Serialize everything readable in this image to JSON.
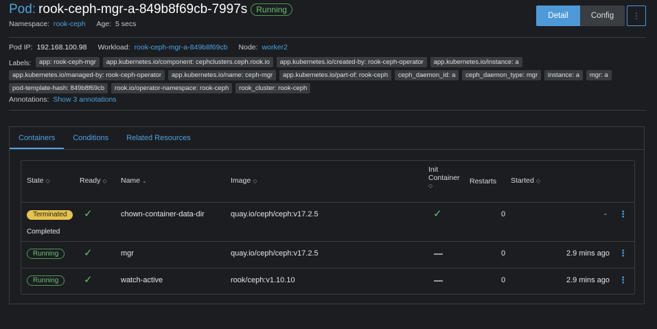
{
  "header": {
    "kind": "Pod:",
    "name": "rook-ceph-mgr-a-849b8f69cb-7997s",
    "status": "Running",
    "namespace_label": "Namespace:",
    "namespace": "rook-ceph",
    "age_label": "Age:",
    "age": "5 secs"
  },
  "buttons": {
    "detail": "Detail",
    "config": "Config",
    "more": "⋮"
  },
  "info": {
    "pod_ip_label": "Pod IP:",
    "pod_ip": "192.168.100.98",
    "workload_label": "Workload:",
    "workload": "rook-ceph-mgr-a-849b8f69cb",
    "node_label": "Node:",
    "node": "worker2"
  },
  "labels_heading": "Labels:",
  "labels": [
    "app: rook-ceph-mgr",
    "app.kubernetes.io/component: cephclusters.ceph.rook.io",
    "app.kubernetes.io/created-by: rook-ceph-operator",
    "app.kubernetes.io/instance: a",
    "app.kubernetes.io/managed-by: rook-ceph-operator",
    "app.kubernetes.io/name: ceph-mgr",
    "app.kubernetes.io/part-of: rook-ceph",
    "ceph_daemon_id: a",
    "ceph_daemon_type: mgr",
    "instance: a",
    "mgr: a",
    "pod-template-hash: 849b8f69cb",
    "rook.io/operator-namespace: rook-ceph",
    "rook_cluster: rook-ceph"
  ],
  "annotations": {
    "label": "Annotations:",
    "link": "Show 3 annotations"
  },
  "tabs": [
    "Containers",
    "Conditions",
    "Related Resources"
  ],
  "table": {
    "headers": {
      "state": "State",
      "ready": "Ready",
      "name": "Name",
      "image": "Image",
      "init_line1": "Init",
      "init_line2": "Container",
      "restarts": "Restarts",
      "started": "Started"
    },
    "rows": [
      {
        "state": "Terminated",
        "state_detail": "Completed",
        "name": "chown-container-data-dir",
        "image": "quay.io/ceph/ceph:v17.2.5",
        "restarts": "0",
        "started": "-"
      },
      {
        "state": "Running",
        "name": "mgr",
        "image": "quay.io/ceph/ceph:v17.2.5",
        "restarts": "0",
        "started": "2.9 mins ago"
      },
      {
        "state": "Running",
        "name": "watch-active",
        "image": "rook/ceph:v1.10.10",
        "restarts": "0",
        "started": "2.9 mins ago"
      }
    ]
  }
}
